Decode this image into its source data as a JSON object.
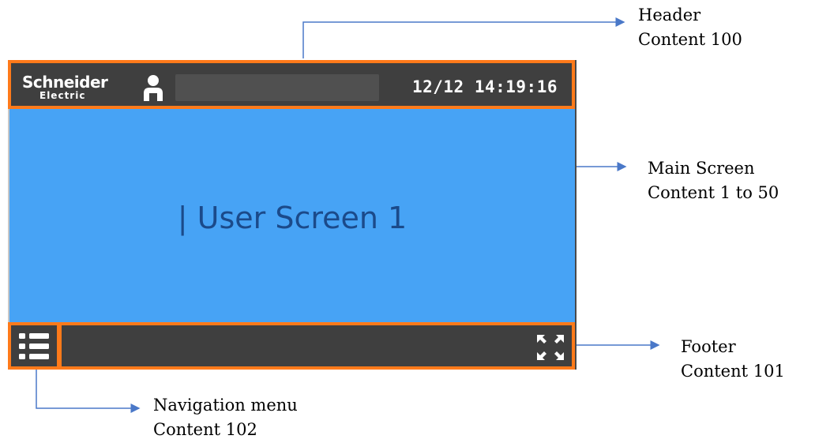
{
  "header": {
    "logo_main": "Schneider",
    "logo_sub": "Electric",
    "datetime": "12/12 14:19:16"
  },
  "main_screen": {
    "title": "| User Screen 1"
  },
  "annotations": {
    "header": [
      "Header",
      "Content 100"
    ],
    "main": [
      "Main Screen",
      "Content 1 to 50"
    ],
    "footer": [
      "Footer",
      "Content 101"
    ],
    "nav": [
      "Navigation menu",
      "Content 102"
    ]
  },
  "colors": {
    "highlight_border": "#ff7a1a",
    "bar_background": "#3f3f3f",
    "screen_background": "#47a3f5",
    "screen_text": "#1b4a8a",
    "arrow": "#4a78c8"
  },
  "icons": {
    "user": "user-icon",
    "nav": "list-menu-icon",
    "expand": "expand-arrows-icon",
    "logo": "schneider-electric-logo"
  }
}
